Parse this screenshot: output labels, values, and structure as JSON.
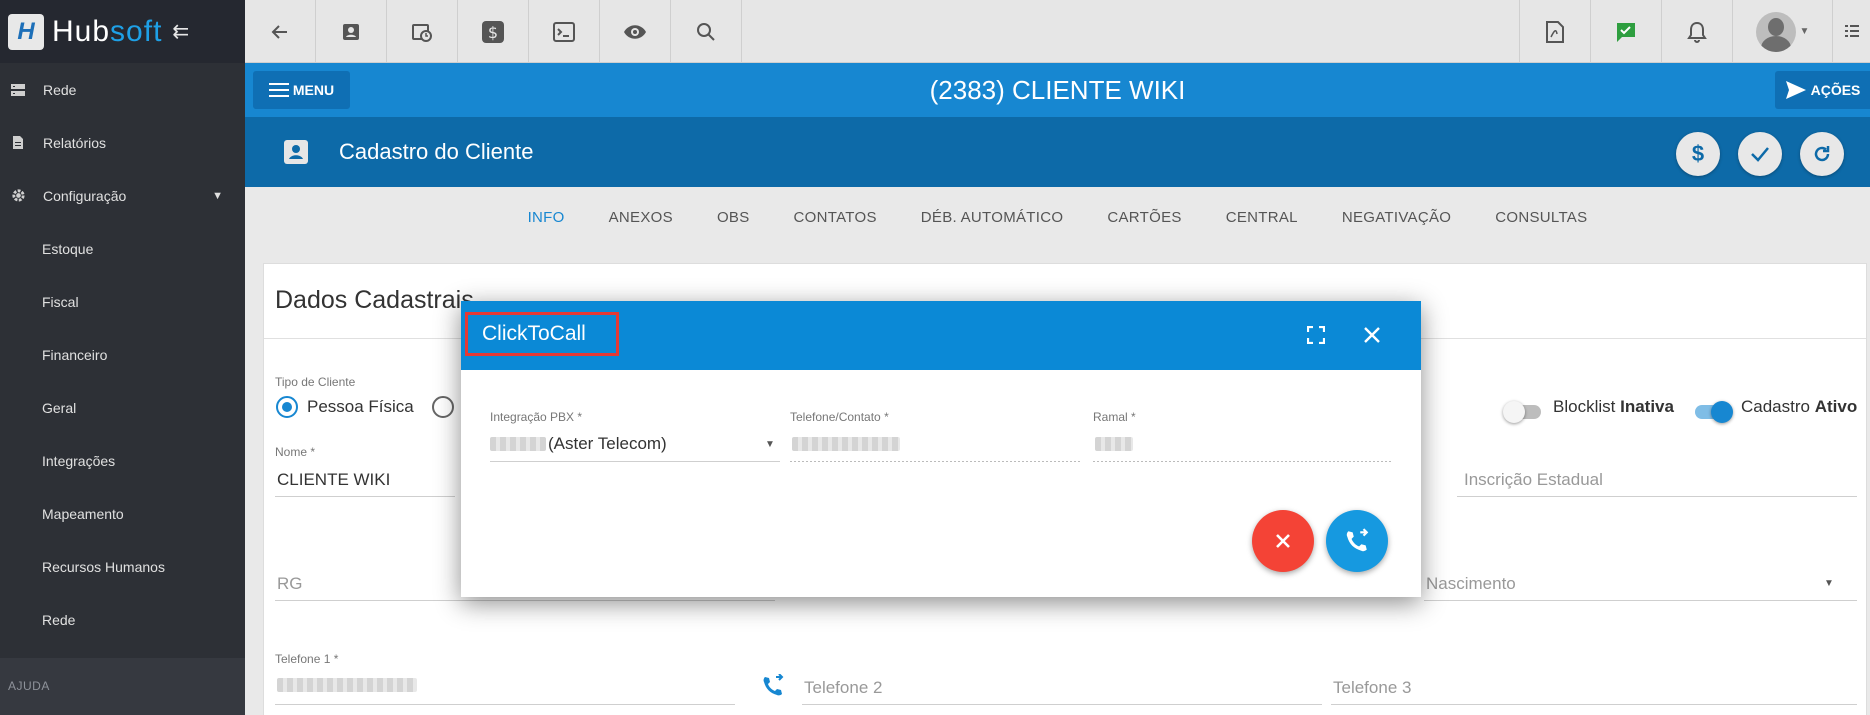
{
  "brand": {
    "name_part1": "Hub",
    "name_part2": "soft"
  },
  "sidebar": {
    "items": [
      {
        "label": "Rede",
        "icon": "server-icon"
      },
      {
        "label": "Relatórios",
        "icon": "document-icon"
      },
      {
        "label": "Configuração",
        "icon": "gear-icon"
      }
    ],
    "subitems": [
      "Estoque",
      "Fiscal",
      "Financeiro",
      "Geral",
      "Integrações",
      "Mapeamento",
      "Recursos Humanos",
      "Rede"
    ],
    "section_label": "AJUDA"
  },
  "header": {
    "menu_label": "MENU",
    "client_title": "(2383) CLIENTE WIKI",
    "actions_label": "AÇÕES",
    "page_title": "Cadastro do Cliente"
  },
  "tabs": [
    "INFO",
    "ANEXOS",
    "OBS",
    "CONTATOS",
    "DÉB. AUTOMÁTICO",
    "CARTÕES",
    "CENTRAL",
    "NEGATIVAÇÃO",
    "CONSULTAS"
  ],
  "form": {
    "title": "Dados Cadastrais",
    "tipo_label": "Tipo de Cliente",
    "tipo_option": "Pessoa Física",
    "blocklist_label": "Blocklist",
    "blocklist_state": "Inativa",
    "cadastro_label": "Cadastro",
    "cadastro_state": "Ativo",
    "nome_label": "Nome *",
    "nome_value": "CLIENTE WIKI",
    "inscricao_placeholder": "Inscrição Estadual",
    "rg_placeholder": "RG",
    "nascimento_placeholder": "Nascimento",
    "telefone1_label": "Telefone 1 *",
    "telefone2_placeholder": "Telefone 2",
    "telefone3_placeholder": "Telefone 3"
  },
  "modal": {
    "title": "ClickToCall",
    "pbx_label": "Integração PBX *",
    "pbx_value": "(Aster Telecom)",
    "telefone_label": "Telefone/Contato *",
    "ramal_label": "Ramal *"
  },
  "colors": {
    "primary": "#1787d1",
    "modal_header": "#0b89d6",
    "danger": "#f44336",
    "sidebar_bg": "#2d3036"
  }
}
